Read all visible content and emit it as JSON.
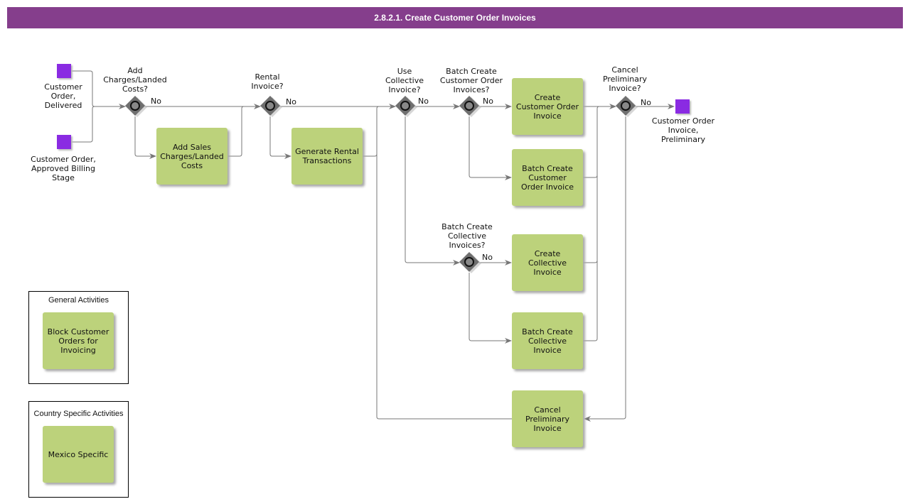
{
  "title": "2.8.2.1. Create Customer Order Invoices",
  "events": {
    "start_delivered": "Customer\nOrder,\nDelivered",
    "start_approved": "Customer Order,\nApproved Billing\nStage",
    "end_preliminary": "Customer Order\nInvoice,\nPreliminary"
  },
  "gateways": {
    "add_charges": "Add\nCharges/Landed\nCosts?",
    "rental": "Rental\nInvoice?",
    "collective": "Use\nCollective\nInvoice?",
    "batch_co": "Batch Create\nCustomer Order\nInvoices?",
    "batch_collective": "Batch Create\nCollective\nInvoices?",
    "cancel": "Cancel\nPreliminary\nInvoice?"
  },
  "no_label": "No",
  "tasks": {
    "add_sales_charges": "Add Sales\nCharges/Landed\nCosts",
    "generate_rental": "Generate Rental\nTransactions",
    "create_co_invoice": "Create\nCustomer Order\nInvoice",
    "batch_co_invoice": "Batch Create\nCustomer\nOrder Invoice",
    "create_collective": "Create\nCollective\nInvoice",
    "batch_collective": "Batch Create\nCollective\nInvoice",
    "cancel_preliminary": "Cancel\nPreliminary\nInvoice"
  },
  "legend": {
    "general": {
      "title": "General Activities",
      "task": "Block Customer\nOrders for\nInvoicing"
    },
    "country": {
      "title": "Country Specific Activities",
      "task": "Mexico Specific"
    }
  }
}
